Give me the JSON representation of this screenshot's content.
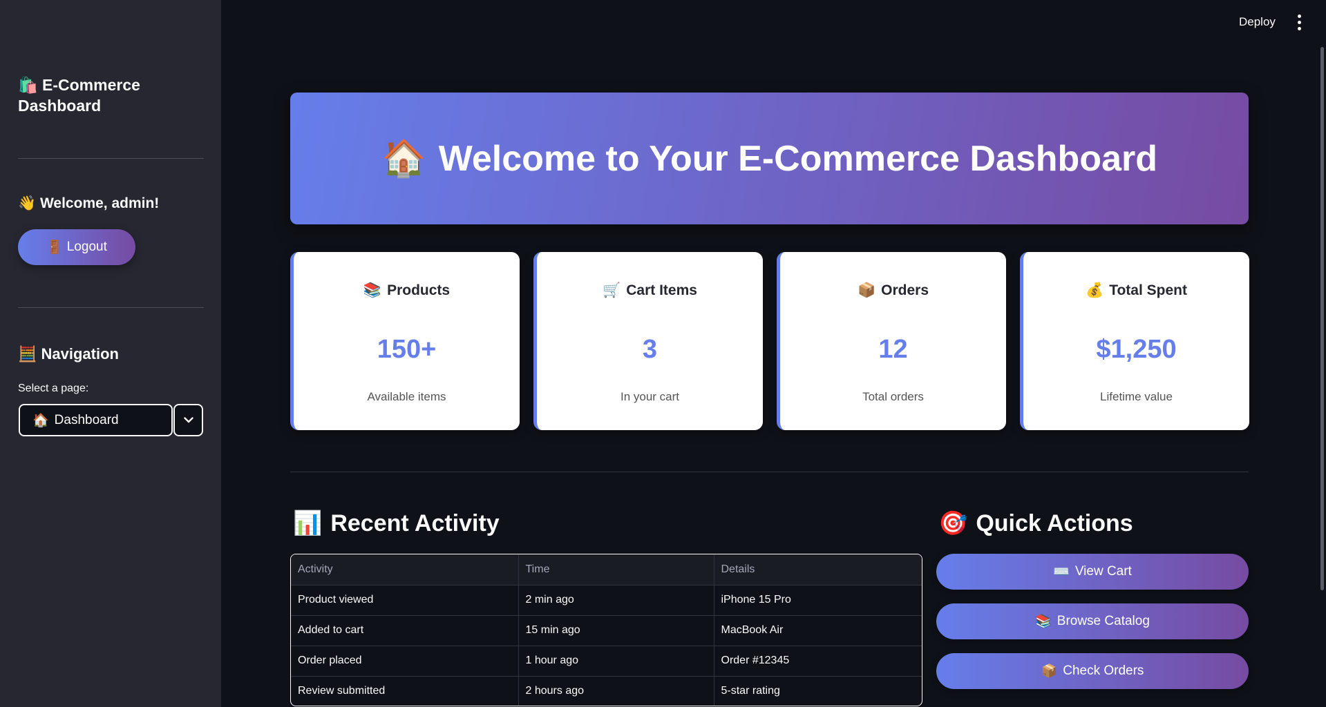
{
  "sidebar": {
    "app_title": "🛍️ E-Commerce Dashboard",
    "welcome": "👋 Welcome, admin!",
    "logout_icon": "🚪",
    "logout_label": "Logout",
    "nav_title": "🧮 Navigation",
    "select_label": "Select a page:",
    "select_icon": "🏠",
    "select_value": "Dashboard"
  },
  "topbar": {
    "deploy_label": "Deploy",
    "menu_icon": "more-vertical-icon"
  },
  "hero": {
    "icon": "🏠",
    "title": "Welcome to Your E-Commerce Dashboard"
  },
  "metrics": [
    {
      "icon": "📚",
      "title": "Products",
      "value": "150+",
      "sub": "Available items"
    },
    {
      "icon": "🛒",
      "title": "Cart Items",
      "value": "3",
      "sub": "In your cart"
    },
    {
      "icon": "📦",
      "title": "Orders",
      "value": "12",
      "sub": "Total orders"
    },
    {
      "icon": "💰",
      "title": "Total Spent",
      "value": "$1,250",
      "sub": "Lifetime value"
    }
  ],
  "activity": {
    "icon": "📊",
    "title": "Recent Activity",
    "columns": [
      "Activity",
      "Time",
      "Details"
    ],
    "rows": [
      [
        "Product viewed",
        "2 min ago",
        "iPhone 15 Pro"
      ],
      [
        "Added to cart",
        "15 min ago",
        "MacBook Air"
      ],
      [
        "Order placed",
        "1 hour ago",
        "Order #12345"
      ],
      [
        "Review submitted",
        "2 hours ago",
        "5-star rating"
      ]
    ]
  },
  "quick_actions": {
    "icon": "🎯",
    "title": "Quick Actions",
    "buttons": [
      {
        "icon": "⌨️",
        "label": "View Cart"
      },
      {
        "icon": "📚",
        "label": "Browse Catalog"
      },
      {
        "icon": "📦",
        "label": "Check Orders"
      }
    ]
  },
  "colors": {
    "accent_start": "#667eea",
    "accent_end": "#764ba2",
    "background": "#0e1117",
    "sidebar": "#262730"
  }
}
